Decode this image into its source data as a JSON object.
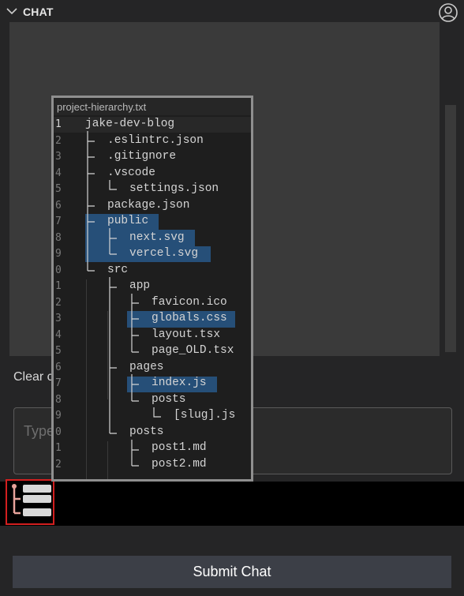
{
  "header": {
    "title": "CHAT"
  },
  "chat": {
    "clear_label": "Clear c"
  },
  "input": {
    "placeholder": "Type"
  },
  "submit": {
    "label": "Submit Chat"
  },
  "preview": {
    "title": "project-hierarchy.txt",
    "line_numbers": [
      "1",
      "2",
      "3",
      "4",
      "5",
      "6",
      "7",
      "8",
      "9",
      "0",
      "1",
      "2",
      "3",
      "4",
      "5",
      "6",
      "7",
      "8",
      "9",
      "0",
      "1",
      "2"
    ],
    "lines": [
      "jake-dev-blog",
      ".eslintrc.json",
      ".gitignore",
      ".vscode",
      "settings.json",
      "package.json",
      "public",
      "next.svg",
      "vercel.svg",
      "src",
      "app",
      "favicon.ico",
      "globals.css",
      "layout.tsx",
      "page_OLD.tsx",
      "pages",
      "index.js",
      "posts",
      "[slug].js",
      "posts",
      "post1.md",
      "post2.md"
    ]
  },
  "icons": {
    "collapse": "chevron-down-icon",
    "account": "account-icon",
    "tree": "tree-view-icon"
  },
  "colors": {
    "selection": "#264f78",
    "highlight_border": "#d21f1f",
    "submit_bg": "#3c3f47"
  }
}
